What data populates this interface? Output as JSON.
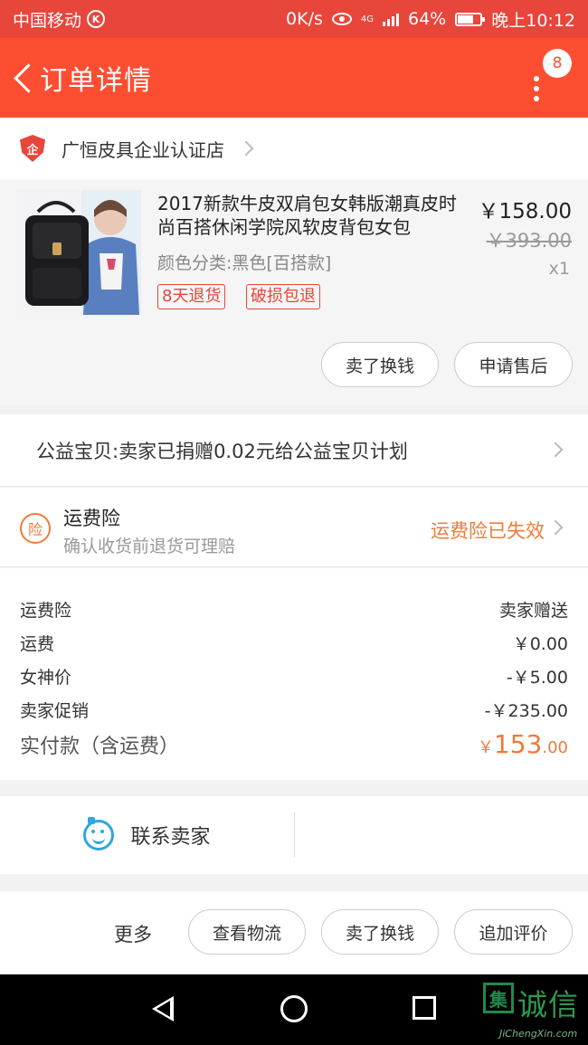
{
  "status_bar": {
    "carrier": "中国移动",
    "carrier_badge": "K",
    "speed": "0K/s",
    "network": "4G",
    "battery": "64%",
    "time": "晚上10:12"
  },
  "navbar": {
    "title": "订单详情",
    "badge_count": "8"
  },
  "shop": {
    "icon_text": "企",
    "name": "广恒皮具企业认证店"
  },
  "product": {
    "title": "2017新款牛皮双肩包女韩版潮真皮时尚百搭休闲学院风软皮背包女包",
    "spec": "颜色分类:黑色[百搭款]",
    "tags": [
      "8天退货",
      "破损包退"
    ],
    "price_now": "￥158.00",
    "price_old": "￥393.00",
    "quantity": "x1",
    "actions": [
      "卖了换钱",
      "申请售后"
    ]
  },
  "charity": {
    "text": "公益宝贝:卖家已捐赠0.02元给公益宝贝计划"
  },
  "insurance": {
    "icon_text": "险",
    "title": "运费险",
    "subtitle": "确认收货前退货可理赔",
    "status": "运费险已失效"
  },
  "summary": {
    "rows": [
      {
        "label": "运费险",
        "value": "卖家赠送"
      },
      {
        "label": "运费",
        "value": "￥0.00"
      },
      {
        "label": "女神价",
        "value": "-￥5.00"
      },
      {
        "label": "卖家促销",
        "value": "-￥235.00"
      }
    ],
    "total_label": "实付款（含运费）",
    "total_currency": "￥",
    "total_int": "153",
    "total_dec": ".00"
  },
  "contact": {
    "label": "联系卖家"
  },
  "actionbar": {
    "more": "更多",
    "buttons": [
      "查看物流",
      "卖了换钱",
      "追加评价"
    ]
  },
  "watermark": {
    "logo": "集",
    "text": "诚信",
    "sub": "JiChengXin.com"
  },
  "colors": {
    "brand": "#fe4e32",
    "accent_orange": "#f07a3a",
    "chat_blue": "#2ea7e0"
  }
}
